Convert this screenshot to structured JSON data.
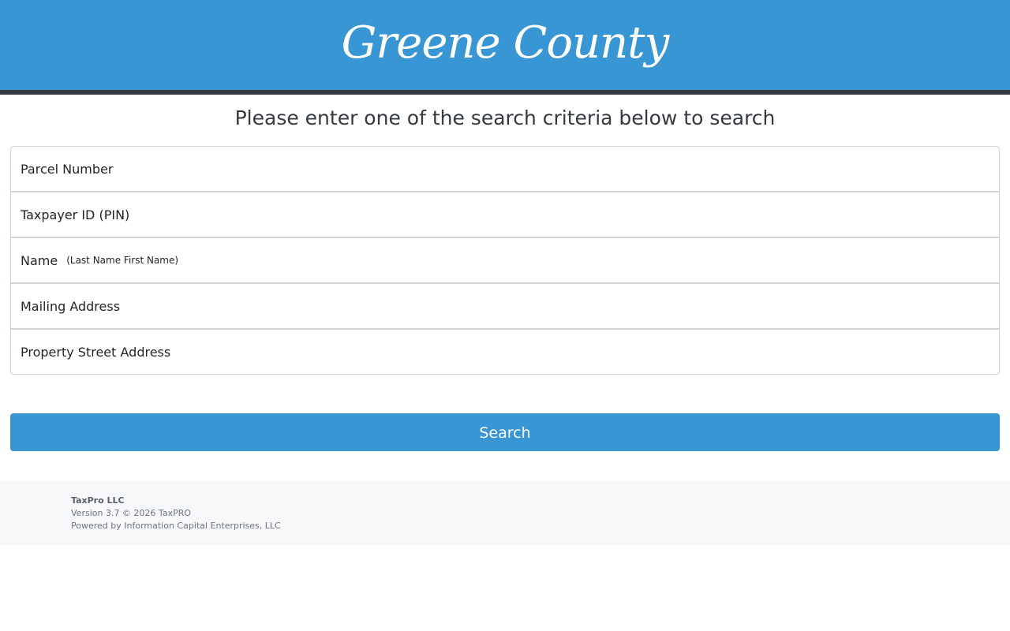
{
  "header": {
    "logo_text": "Greene County",
    "brand_color": "#3796d3"
  },
  "instructions": "Please enter one of the search criteria below to search",
  "fields": [
    {
      "label": "Parcel Number",
      "hint": ""
    },
    {
      "label": "Taxpayer ID (PIN)",
      "hint": ""
    },
    {
      "label": "Name",
      "hint": "(Last Name First Name)"
    },
    {
      "label": "Mailing Address",
      "hint": ""
    },
    {
      "label": "Property Street Address",
      "hint": ""
    }
  ],
  "search_button": {
    "label": "Search"
  },
  "footer": {
    "company": "TaxPro LLC",
    "version": "Version 3.7 © 2026 TaxPRO",
    "powered_by": "Powered by Information Capital Enterprises, LLC"
  }
}
